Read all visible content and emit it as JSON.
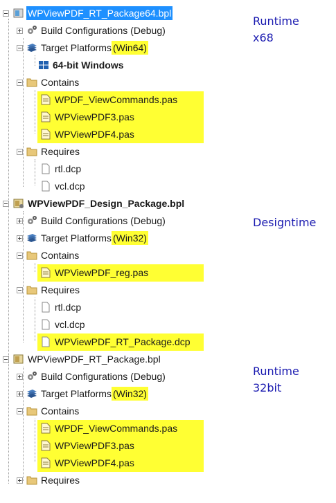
{
  "packages": [
    {
      "name": "WPViewPDF_RT_Package64.bpl",
      "selected": true,
      "build_config": "Build Configurations (Debug)",
      "target_label": "Target Platforms",
      "target_platform": "(Win64)",
      "platform_item": "64-bit Windows",
      "contains_label": "Contains",
      "contains": [
        "WPDF_ViewCommands.pas",
        "WPViewPDF3.pas",
        "WPViewPDF4.pas"
      ],
      "requires_label": "Requires",
      "requires": [
        "rtl.dcp",
        "vcl.dcp"
      ]
    },
    {
      "name": "WPViewPDF_Design_Package.bpl",
      "bold": true,
      "build_config": "Build Configurations (Debug)",
      "target_label": "Target Platforms",
      "target_platform": "(Win32)",
      "contains_label": "Contains",
      "contains": [
        "WPViewPDF_reg.pas"
      ],
      "requires_label": "Requires",
      "requires": [
        "rtl.dcp",
        "vcl.dcp",
        "WPViewPDF_RT_Package.dcp"
      ]
    },
    {
      "name": "WPViewPDF_RT_Package.bpl",
      "build_config": "Build Configurations (Debug)",
      "target_label": "Target Platforms",
      "target_platform": "(Win32)",
      "contains_label": "Contains",
      "contains": [
        "WPDF_ViewCommands.pas",
        "WPViewPDF3.pas",
        "WPViewPDF4.pas"
      ],
      "requires_label": "Requires"
    }
  ],
  "annotations": {
    "runtime64": [
      "Runtime",
      "x68"
    ],
    "designtime": "Designtime",
    "runtime32": [
      "Runtime",
      "32bit"
    ]
  },
  "colors": {
    "highlight": "#ffff33",
    "selection": "#1e90ff",
    "annotation": "#1a1ab0"
  }
}
